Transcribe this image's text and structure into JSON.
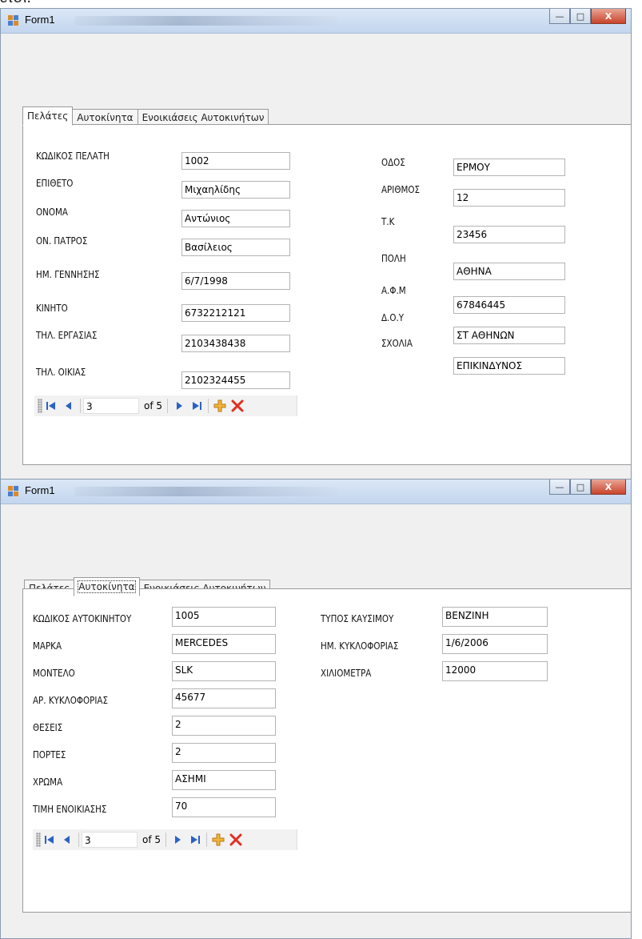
{
  "page_caption": "έτσι.",
  "window1": {
    "title": "Form1",
    "minimize": "—",
    "maximize": "□",
    "close": "X",
    "tabs": [
      {
        "label": "Πελάτες"
      },
      {
        "label": "Αυτοκίνητα"
      },
      {
        "label": "Ενοικιάσεις Αυτοκινήτων"
      }
    ],
    "active_tab": "Πελάτες",
    "fields_left": [
      {
        "label": "ΚΩΔΙΚΟΣ ΠΕΛΑΤΗ",
        "value": "1002"
      },
      {
        "label": "ΕΠΙΘΕΤΟ",
        "value": "Μιχαηλίδης"
      },
      {
        "label": "ΟΝΟΜΑ",
        "value": "Αντώνιος"
      },
      {
        "label": "ΟΝ. ΠΑΤΡΟΣ",
        "value": "Βασίλειος"
      },
      {
        "label": "ΗΜ. ΓΕΝΝΗΣΗΣ",
        "value": "6/7/1998"
      },
      {
        "label": "ΚΙΝΗΤΟ",
        "value": "6732212121"
      },
      {
        "label": "ΤΗΛ. ΕΡΓΑΣΙΑΣ",
        "value": "2103438438"
      },
      {
        "label": "ΤΗΛ. ΟΙΚΙΑΣ",
        "value": "2102324455"
      }
    ],
    "fields_right": [
      {
        "label": "ΟΔΟΣ",
        "value": "ΕΡΜΟΥ"
      },
      {
        "label": "ΑΡΙΘΜΟΣ",
        "value": "12"
      },
      {
        "label": "Τ.Κ",
        "value": "23456"
      },
      {
        "label": "ΠΟΛΗ",
        "value": "ΑΘΗΝΑ"
      },
      {
        "label": "Α.Φ.Μ",
        "value": "67846445"
      },
      {
        "label": "Δ.Ο.Υ",
        "value": "ΣΤ ΑΘΗΝΩΝ"
      },
      {
        "label": "ΣΧΟΛΙΑ",
        "value": "ΕΠΙΚΙΝΔΥΝΟΣ"
      }
    ],
    "navigator": {
      "position": "3",
      "count": "of 5"
    }
  },
  "window2": {
    "title": "Form1",
    "minimize": "—",
    "maximize": "□",
    "close": "X",
    "tabs": [
      {
        "label": "Πελάτες"
      },
      {
        "label": "Αυτοκίνητα"
      },
      {
        "label": "Ενοικιάσεις Αυτοκινήτων"
      }
    ],
    "active_tab": "Αυτοκίνητα",
    "fields_left": [
      {
        "label": "ΚΩΔΙΚΟΣ ΑΥΤΟΚΙΝΗΤΟΥ",
        "value": "1005"
      },
      {
        "label": "ΜΑΡΚΑ",
        "value": "MERCEDES"
      },
      {
        "label": "ΜΟΝΤΕΛΟ",
        "value": "SLK"
      },
      {
        "label": "ΑΡ. ΚΥΚΛΟΦΟΡΙΑΣ",
        "value": "45677"
      },
      {
        "label": "ΘΕΣΕΙΣ",
        "value": "2"
      },
      {
        "label": "ΠΟΡΤΕΣ",
        "value": "2"
      },
      {
        "label": "ΧΡΩΜΑ",
        "value": "ΑΣΗΜΙ"
      },
      {
        "label": "ΤΙΜΗ ΕΝΟΙΚΙΑΣΗΣ",
        "value": "70"
      }
    ],
    "fields_right": [
      {
        "label": "ΤΥΠΟΣ ΚΑΥΣΙΜΟΥ",
        "value": "ΒΕΝΖΙΝΗ"
      },
      {
        "label": "ΗΜ. ΚΥΚΛΟΦΟΡΙΑΣ",
        "value": "1/6/2006"
      },
      {
        "label": "ΧΙΛΙΟΜΕΤΡΑ",
        "value": "12000"
      }
    ],
    "navigator": {
      "position": "3",
      "count": "of 5"
    }
  },
  "icons": {
    "app": "form-app-icon",
    "first": "move-first-icon",
    "prev": "move-previous-icon",
    "next": "move-next-icon",
    "last": "move-last-icon",
    "add": "add-new-icon",
    "delete": "delete-icon"
  },
  "colors": {
    "nav_arrow": "#2a62c4",
    "add_icon": "#e8a317",
    "delete_icon": "#e03020"
  }
}
